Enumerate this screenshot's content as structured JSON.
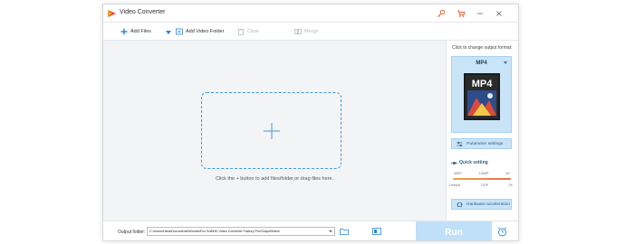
{
  "app": {
    "title": "Video Converter"
  },
  "toolbar": {
    "add_files": "Add Files",
    "add_video_folder": "Add Video Folder",
    "clear": "Clear",
    "merge": "Merge"
  },
  "main": {
    "drop_hint": "Click the + button to add files/folder,or drag files here."
  },
  "side": {
    "hint": "Click to change output format:",
    "format": "MP4",
    "format_badge": "MP4",
    "parameter_settings": "Parameter settings",
    "quick_setting": "Quick setting",
    "slider_top": [
      "480P",
      "1080P",
      "4K"
    ],
    "slider_bottom": [
      "Default",
      "720P",
      "2K"
    ],
    "hardware_acceleration": "Hardware acceleration"
  },
  "bottom": {
    "output_label": "Output folder:",
    "output_path": "C:\\Users\\Hans\\Documents\\WonderFox Soft\\HD Video Converter Factory Pro\\OutputVideo\\",
    "run": "Run"
  },
  "colors": {
    "accent": "#3c9be0",
    "card": "#c9e3f7",
    "run": "#bfe0f8",
    "logo": "#e8462d"
  }
}
